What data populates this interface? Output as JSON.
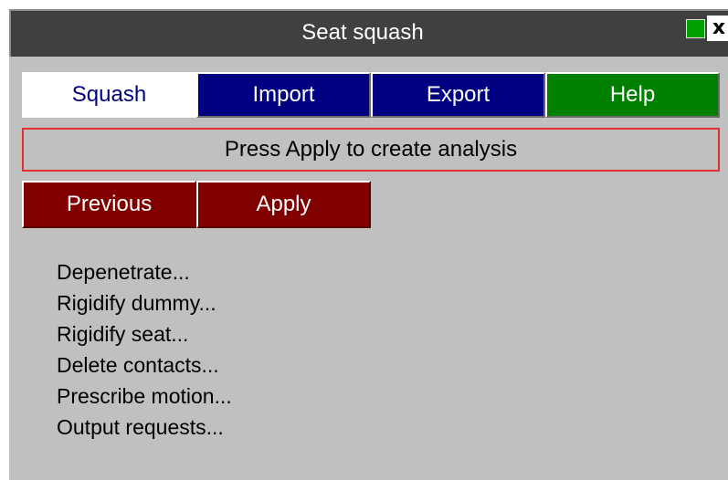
{
  "window": {
    "title": "Seat squash",
    "close_label": "x"
  },
  "tabs": [
    {
      "label": "Squash",
      "active": true,
      "color": "#ffffff"
    },
    {
      "label": "Import",
      "active": false,
      "color": "#000080"
    },
    {
      "label": "Export",
      "active": false,
      "color": "#000080"
    },
    {
      "label": "Help",
      "active": false,
      "color": "#008000"
    }
  ],
  "status": {
    "message": "Press Apply to create analysis",
    "border_color": "#e03030"
  },
  "actions": {
    "previous_label": "Previous",
    "apply_label": "Apply",
    "color": "#800000"
  },
  "menu": {
    "items": [
      {
        "label": "Depenetrate..."
      },
      {
        "label": "Rigidify dummy..."
      },
      {
        "label": "Rigidify seat..."
      },
      {
        "label": "Delete contacts..."
      },
      {
        "label": "Prescribe motion..."
      },
      {
        "label": "Output requests..."
      }
    ]
  },
  "icons": {
    "pin": "green-square-pin-icon",
    "close": "close-icon"
  }
}
